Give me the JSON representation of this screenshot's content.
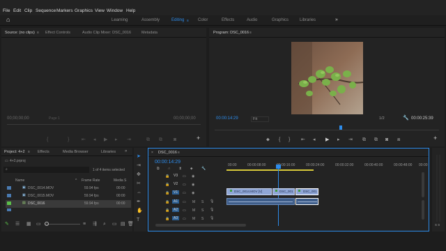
{
  "menu": [
    "File",
    "Edit",
    "Clip",
    "Sequence",
    "Markers",
    "Graphics",
    "View",
    "Window",
    "Help"
  ],
  "workspaces": [
    "Learning",
    "Assembly",
    "Editing",
    "Color",
    "Effects",
    "Audio",
    "Graphics",
    "Libraries"
  ],
  "active_workspace": "Editing",
  "source": {
    "tabs": [
      "Source: (no clips)",
      "Effect Controls",
      "Audio Clip Mixer: DSC_0016",
      "Metadata"
    ],
    "timecode_left": "00;00;00;00",
    "page": "Page 1",
    "timecode_right": "00;00;00;00"
  },
  "program": {
    "tab": "Program: DSC_0016",
    "timecode": "00:00:14:29",
    "fit": "Fit",
    "ratio": "1/2",
    "duration": "00:00:25:39"
  },
  "project": {
    "tabs": [
      "Project: 4+2",
      "Effects",
      "Media Browser",
      "Libraries"
    ],
    "filename": "4+2.prproj",
    "selection": "1 of 4 items selected",
    "columns": [
      "Name",
      "Frame Rate",
      "Media S"
    ],
    "items": [
      {
        "name": "DSC_0014.MOV",
        "rate": "59.94 fps",
        "media": "00:00"
      },
      {
        "name": "DSC_0015.MOV",
        "rate": "59.94 fps",
        "media": "00:00"
      },
      {
        "name": "DSC_0016",
        "rate": "59.94 fps",
        "media": "00:00"
      }
    ]
  },
  "timeline": {
    "tab": "DSC_0016",
    "timecode": "00:00:14:29",
    "ruler": [
      "00:00",
      "00:00:08:00",
      "00:00:16:00",
      "00:00:24:00",
      "00:00:32:00",
      "00:00:40:00",
      "00:00:48:00",
      "00:00"
    ],
    "tracks": [
      "V3",
      "V2",
      "V1",
      "A1",
      "A2",
      "A3"
    ],
    "clips": [
      "DSC_0014.MOV [V]",
      "DSC_001",
      "DSC_001"
    ]
  },
  "meter": "S S"
}
